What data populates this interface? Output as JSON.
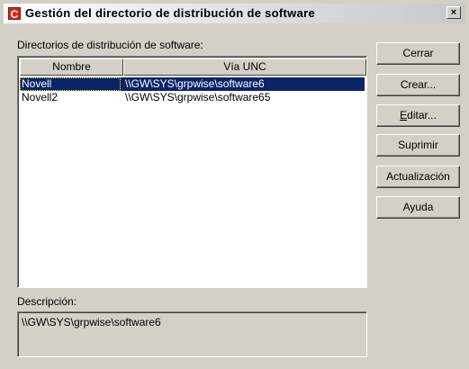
{
  "window": {
    "title": "Gestión del directorio de distribución de software",
    "icon": "C",
    "close_label": "×"
  },
  "list": {
    "label": "Directorios de distribución de software:",
    "columns": [
      "Nombre",
      "Vía UNC"
    ],
    "rows": [
      {
        "name": "Novell",
        "unc": "\\\\GW\\SYS\\grpwise\\software6",
        "selected": true
      },
      {
        "name": "Novell2",
        "unc": "\\\\GW\\SYS\\grpwise\\software65",
        "selected": false
      }
    ]
  },
  "description": {
    "label": "Descripción:",
    "value": "\\\\GW\\SYS\\grpwise\\software6"
  },
  "buttons": {
    "close": "Cerrar",
    "create": "Crear...",
    "edit_mnemonic": "E",
    "edit_rest": "ditar...",
    "delete": "Suprimir",
    "update": "Actualización",
    "help": "Ayuda"
  },
  "colors": {
    "selection_bg": "#0a246a",
    "dialog_bg": "#d4d0c8",
    "icon_red": "#d7261e"
  }
}
